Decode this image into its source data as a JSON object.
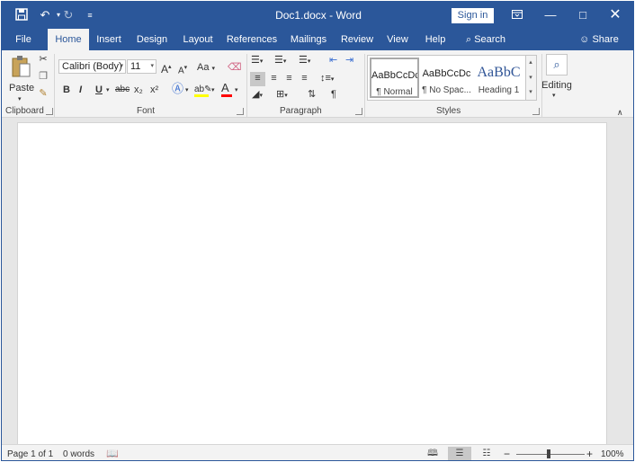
{
  "title_bar": {
    "title": "Doc1.docx - Word",
    "sign_in_label": "Sign in",
    "save_icon": "save-icon",
    "undo_icon": "undo-icon",
    "redo_icon": "redo-icon",
    "customize_icon": "customize-qat-icon"
  },
  "tabs": [
    {
      "label": "File"
    },
    {
      "label": "Home",
      "active": true
    },
    {
      "label": "Insert"
    },
    {
      "label": "Design"
    },
    {
      "label": "Layout"
    },
    {
      "label": "References"
    },
    {
      "label": "Mailings"
    },
    {
      "label": "Review"
    },
    {
      "label": "View"
    },
    {
      "label": "Help"
    }
  ],
  "search_label": "Search",
  "share_label": "Share",
  "clipboard": {
    "paste_label": "Paste",
    "group_label": "Clipboard"
  },
  "font": {
    "font_name": "Calibri (Body)",
    "font_size": "11",
    "group_label": "Font",
    "bold": "B",
    "italic": "I",
    "underline": "U",
    "strikethrough": "abc",
    "subscript": "x₂",
    "superscript": "x²",
    "grow": "A",
    "shrink": "A",
    "change_case": "Aa",
    "font_color": "A"
  },
  "paragraph": {
    "group_label": "Paragraph",
    "pilcrow": "¶"
  },
  "styles": {
    "group_label": "Styles",
    "items": [
      {
        "preview": "AaBbCcDc",
        "name": "¶ Normal",
        "selected": true
      },
      {
        "preview": "AaBbCcDc",
        "name": "¶ No Spac..."
      },
      {
        "preview": "AaBbC",
        "name": "Heading 1"
      }
    ]
  },
  "editing": {
    "label": "Editing"
  },
  "status_bar": {
    "page": "Page 1 of 1",
    "words": "0 words",
    "zoom": "100%",
    "zoom_minus": "−",
    "zoom_plus": "+"
  },
  "colors": {
    "brand": "#2b579a",
    "highlight": "#ffff00",
    "font_color": "#ff0000"
  }
}
